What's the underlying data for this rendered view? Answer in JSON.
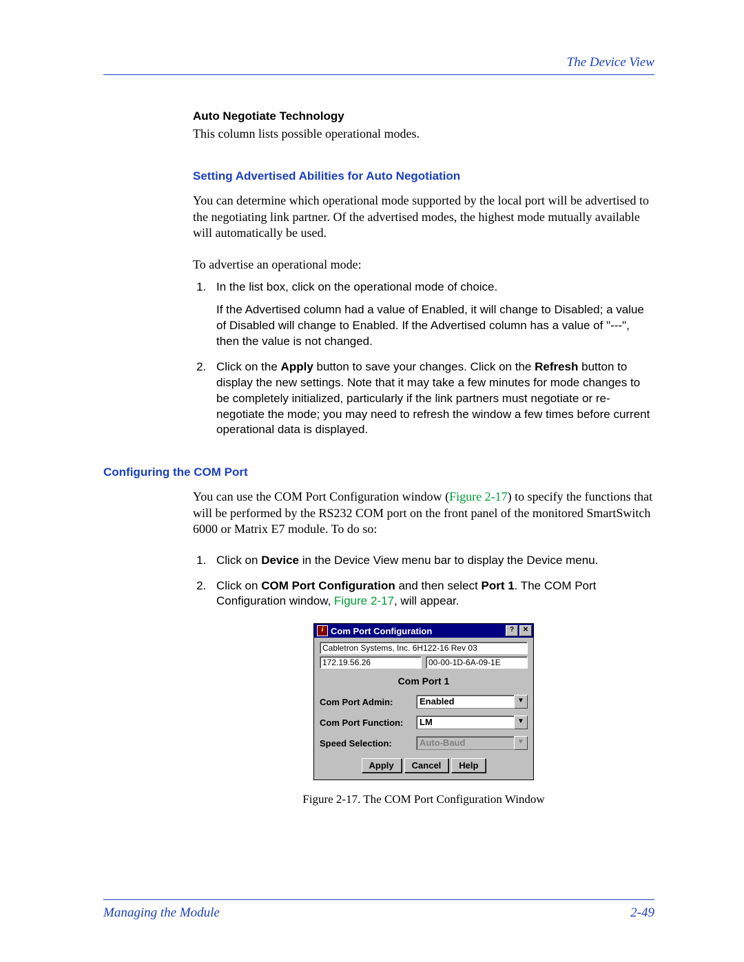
{
  "header": {
    "title": "The Device View"
  },
  "section1": {
    "heading": "Auto Negotiate Technology",
    "text": "This column lists possible operational modes."
  },
  "section2": {
    "heading": "Setting Advertised Abilities for Auto Negotiation",
    "para1": "You can determine which operational mode supported by the local port will be advertised to the negotiating link partner. Of the advertised modes, the highest mode mutually available will automatically be used.",
    "para2": "To advertise an operational mode:",
    "step1": "In the list box, click on the operational mode of choice.",
    "step1_sub": "If the Advertised column had a value of Enabled, it will change to Disabled; a value of Disabled will change to Enabled. If the Advertised column has a value of \"---\", then the value is not changed.",
    "step2_a": "Click on the ",
    "step2_b_bold": "Apply",
    "step2_c": " button to save your changes. Click on the ",
    "step2_d_bold": "Refresh",
    "step2_e": " button to display the new settings. Note that it may take a few minutes for mode changes to be completely initialized, particularly if the link partners must negotiate or re-negotiate the mode; you may need to refresh the window a few times before current operational data is displayed."
  },
  "section3": {
    "heading": "Configuring the COM Port",
    "para_a": "You can use the COM Port Configuration window (",
    "para_link1": "Figure 2-17",
    "para_b": ") to specify the functions that will be performed by the RS232 COM port on the front panel of the monitored SmartSwitch 6000 or Matrix E7 module. To do so:",
    "step1_a": "Click on ",
    "step1_b_bold": "Device",
    "step1_c": " in the Device View menu bar to display the Device menu.",
    "step2_a": "Click on ",
    "step2_b_bold": "COM Port Configuration",
    "step2_c": " and then select ",
    "step2_d_bold": "Port 1",
    "step2_e": ". The COM Port Configuration window, ",
    "step2_link": "Figure 2-17",
    "step2_f": ", will appear."
  },
  "dialog": {
    "title": "Com Port Configuration",
    "help_btn": "?",
    "close_btn": "✕",
    "device_desc": "Cabletron Systems, Inc. 6H122-16 Rev 03",
    "ip": "172.19.56.26",
    "mac": "00-00-1D-6A-09-1E",
    "section_title": "Com Port 1",
    "label_admin": "Com Port Admin:",
    "value_admin": "Enabled",
    "label_function": "Com Port Function:",
    "value_function": "LM",
    "label_speed": "Speed Selection:",
    "value_speed": "Auto-Baud",
    "btn_apply": "Apply",
    "btn_cancel": "Cancel",
    "btn_help": "Help"
  },
  "caption": "Figure 2-17.  The COM Port Configuration Window",
  "footer": {
    "left": "Managing the Module",
    "right": "2-49"
  }
}
